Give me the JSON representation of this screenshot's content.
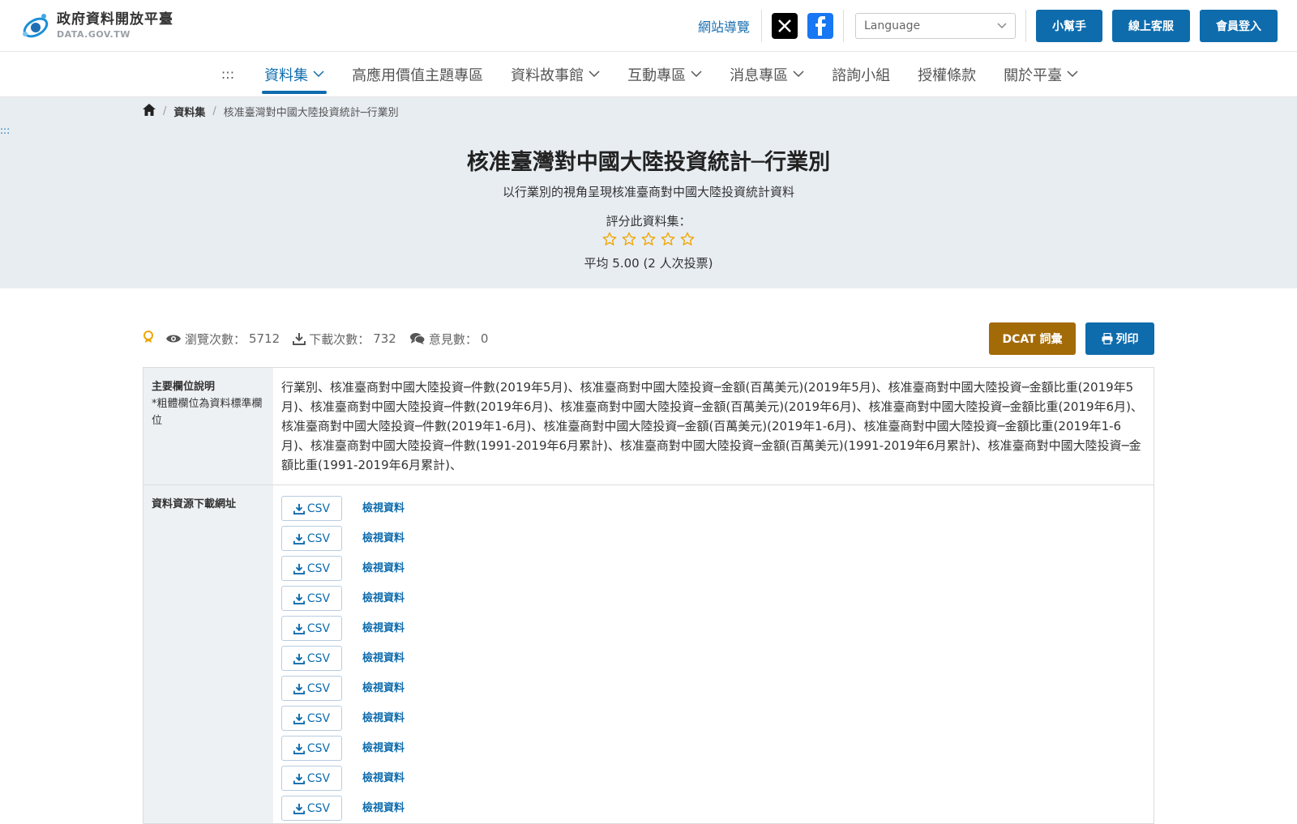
{
  "header": {
    "logo_title": "政府資料開放平臺",
    "logo_sub": "DATA.GOV.TW",
    "sitemap_label": "網站導覽",
    "language_placeholder": "Language",
    "helper_label": "小幫手",
    "support_label": "線上客服",
    "login_label": "會員登入"
  },
  "nav": {
    "accesskey": ":::",
    "items": [
      {
        "label": "資料集",
        "dropdown": true,
        "active": true
      },
      {
        "label": "高應用價值主題專區",
        "dropdown": false
      },
      {
        "label": "資料故事館",
        "dropdown": true
      },
      {
        "label": "互動專區",
        "dropdown": true
      },
      {
        "label": "消息專區",
        "dropdown": true
      },
      {
        "label": "諮詢小組",
        "dropdown": false
      },
      {
        "label": "授權條款",
        "dropdown": false
      },
      {
        "label": "關於平臺",
        "dropdown": true
      }
    ]
  },
  "breadcrumb": {
    "items": [
      "資料集",
      "核准臺灣對中國大陸投資統計─行業別"
    ]
  },
  "hero": {
    "accesskey": ":::",
    "title": "核准臺灣對中國大陸投資統計─行業別",
    "description": "以行業別的視角呈現核准臺商對中國大陸投資統計資料",
    "rate_label": "評分此資料集：",
    "stars_total": 5,
    "rating_average": "平均 5.00 (2 人次投票)"
  },
  "stats": {
    "views_label": "瀏覽次數：",
    "views_value": "5712",
    "downloads_label": "下載次數：",
    "downloads_value": "732",
    "comments_label": "意見數：",
    "comments_value": "0",
    "dcat_label": "DCAT 詞彙",
    "print_label": "列印"
  },
  "table": {
    "fields_header": "主要欄位說明",
    "fields_note": "*粗體欄位為資料標準欄位",
    "fields_text": "行業別、核准臺商對中國大陸投資─件數(2019年5月)、核准臺商對中國大陸投資─金額(百萬美元)(2019年5月)、核准臺商對中國大陸投資─金額比重(2019年5月)、核准臺商對中國大陸投資─件數(2019年6月)、核准臺商對中國大陸投資─金額(百萬美元)(2019年6月)、核准臺商對中國大陸投資─金額比重(2019年6月)、核准臺商對中國大陸投資─件數(2019年1-6月)、核准臺商對中國大陸投資─金額(百萬美元)(2019年1-6月)、核准臺商對中國大陸投資─金額比重(2019年1-6月)、核准臺商對中國大陸投資─件數(1991-2019年6月累計)、核准臺商對中國大陸投資─金額(百萬美元)(1991-2019年6月累計)、核准臺商對中國大陸投資─金額比重(1991-2019年6月累計)、",
    "resources_header": "資料資源下載網址",
    "resources": [
      {
        "format": "CSV",
        "view": "檢視資料"
      },
      {
        "format": "CSV",
        "view": "檢視資料"
      },
      {
        "format": "CSV",
        "view": "檢視資料"
      },
      {
        "format": "CSV",
        "view": "檢視資料"
      },
      {
        "format": "CSV",
        "view": "檢視資料"
      },
      {
        "format": "CSV",
        "view": "檢視資料"
      },
      {
        "format": "CSV",
        "view": "檢視資料"
      },
      {
        "format": "CSV",
        "view": "檢視資料"
      },
      {
        "format": "CSV",
        "view": "檢視資料"
      },
      {
        "format": "CSV",
        "view": "檢視資料"
      },
      {
        "format": "CSV",
        "view": "檢視資料"
      }
    ]
  },
  "colors": {
    "primary": "#0e6cad",
    "dcat": "#a36a08",
    "hero_bg": "#e8edf2",
    "star": "#f0a500"
  }
}
